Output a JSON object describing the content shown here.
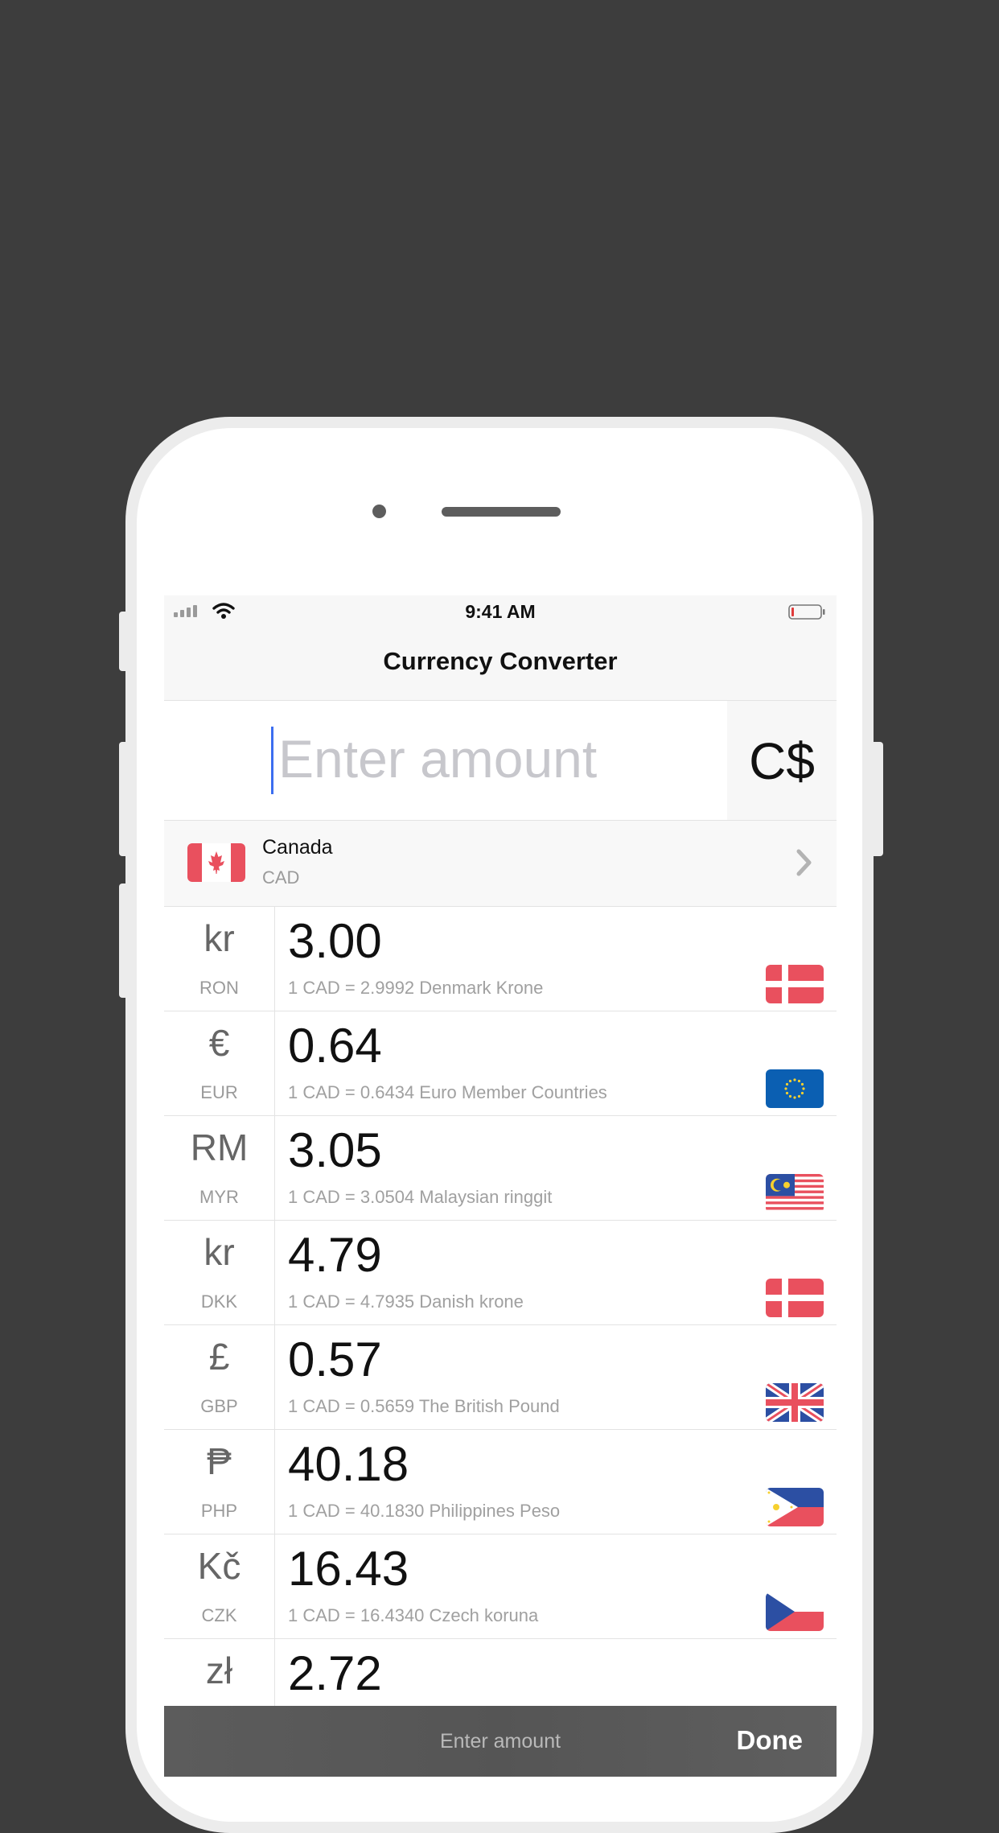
{
  "status_bar": {
    "time": "9:41 AM"
  },
  "nav": {
    "title": "Currency Converter"
  },
  "amount": {
    "placeholder": "Enter amount",
    "value": "",
    "symbol": "C$"
  },
  "base": {
    "country": "Canada",
    "code": "CAD",
    "flag": "canada-flag-icon"
  },
  "rates": [
    {
      "symbol": "kr",
      "code": "RON",
      "value": "3.00",
      "desc": "1 CAD = 2.9992 Denmark Krone",
      "flag": "denmark-flag-icon"
    },
    {
      "symbol": "€",
      "code": "EUR",
      "value": "0.64",
      "desc": "1 CAD = 0.6434 Euro Member Countries",
      "flag": "eu-flag-icon"
    },
    {
      "symbol": "RM",
      "code": "MYR",
      "value": "3.05",
      "desc": "1 CAD = 3.0504 Malaysian ringgit",
      "flag": "malaysia-flag-icon"
    },
    {
      "symbol": "kr",
      "code": "DKK",
      "value": "4.79",
      "desc": "1 CAD = 4.7935 Danish krone",
      "flag": "denmark-flag-icon"
    },
    {
      "symbol": "£",
      "code": "GBP",
      "value": "0.57",
      "desc": "1 CAD = 0.5659 The British Pound",
      "flag": "uk-flag-icon"
    },
    {
      "symbol": "₱",
      "code": "PHP",
      "value": "40.18",
      "desc": "1 CAD = 40.1830 Philippines Peso",
      "flag": "philippines-flag-icon"
    },
    {
      "symbol": "Kč",
      "code": "CZK",
      "value": "16.43",
      "desc": "1 CAD = 16.4340 Czech koruna",
      "flag": "czech-flag-icon"
    },
    {
      "symbol": "zł",
      "code": "",
      "value": "2.72",
      "desc": "",
      "flag": ""
    }
  ],
  "keyboard_toolbar": {
    "placeholder": "Enter amount",
    "done_label": "Done"
  },
  "colors": {
    "background": "#3d3d3d",
    "accent_caret": "#3c6ef0",
    "flag_red": "#e9505e"
  }
}
